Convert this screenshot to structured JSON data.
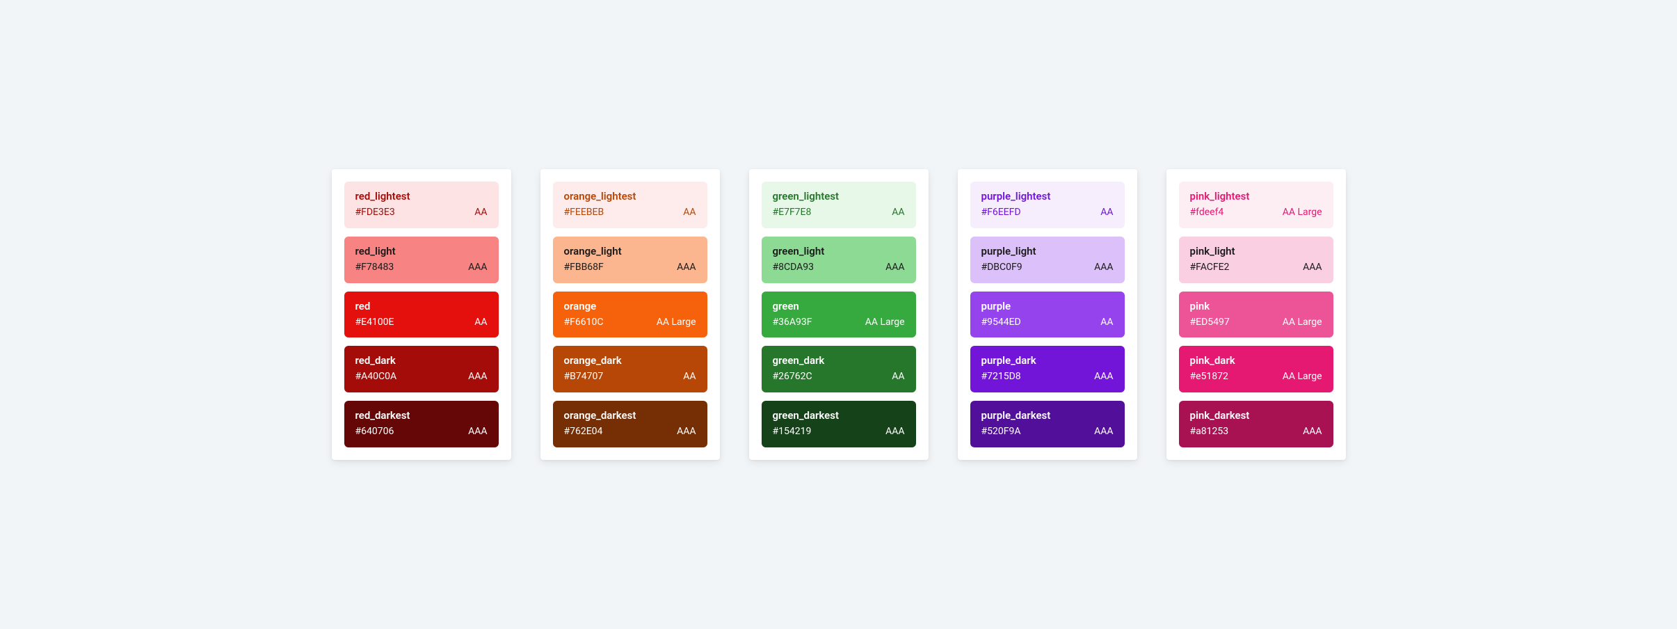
{
  "groups": [
    {
      "swatches": [
        {
          "name": "red_lightest",
          "hex": "#FDE3E3",
          "rating": "AA",
          "bg": "#FDE3E3",
          "fg": "#A40C0A"
        },
        {
          "name": "red_light",
          "hex": "#F78483",
          "rating": "AAA",
          "bg": "#F78483",
          "fg": "#1a1a1a"
        },
        {
          "name": "red",
          "hex": "#E4100E",
          "rating": "AA",
          "bg": "#E4100E",
          "fg": "#ffffff"
        },
        {
          "name": "red_dark",
          "hex": "#A40C0A",
          "rating": "AAA",
          "bg": "#A40C0A",
          "fg": "#ffffff"
        },
        {
          "name": "red_darkest",
          "hex": "#640706",
          "rating": "AAA",
          "bg": "#640706",
          "fg": "#ffffff"
        }
      ]
    },
    {
      "swatches": [
        {
          "name": "orange_lightest",
          "hex": "#FEEBEB",
          "rating": "AA",
          "bg": "#FEEBEB",
          "fg": "#B74707"
        },
        {
          "name": "orange_light",
          "hex": "#FBB68F",
          "rating": "AAA",
          "bg": "#FBB68F",
          "fg": "#1a1a1a"
        },
        {
          "name": "orange",
          "hex": "#F6610C",
          "rating": "AA Large",
          "bg": "#F6610C",
          "fg": "#ffffff"
        },
        {
          "name": "orange_dark",
          "hex": "#B74707",
          "rating": "AA",
          "bg": "#B74707",
          "fg": "#ffffff"
        },
        {
          "name": "orange_darkest",
          "hex": "#762E04",
          "rating": "AAA",
          "bg": "#762E04",
          "fg": "#ffffff"
        }
      ]
    },
    {
      "swatches": [
        {
          "name": "green_lightest",
          "hex": "#E7F7E8",
          "rating": "AA",
          "bg": "#E7F7E8",
          "fg": "#26762C"
        },
        {
          "name": "green_light",
          "hex": "#8CDA93",
          "rating": "AAA",
          "bg": "#8CDA93",
          "fg": "#1a1a1a"
        },
        {
          "name": "green",
          "hex": "#36A93F",
          "rating": "AA Large",
          "bg": "#36A93F",
          "fg": "#ffffff"
        },
        {
          "name": "green_dark",
          "hex": "#26762C",
          "rating": "AA",
          "bg": "#26762C",
          "fg": "#ffffff"
        },
        {
          "name": "green_darkest",
          "hex": "#154219",
          "rating": "AAA",
          "bg": "#154219",
          "fg": "#ffffff"
        }
      ]
    },
    {
      "swatches": [
        {
          "name": "purple_lightest",
          "hex": "#F6EEFD",
          "rating": "AA",
          "bg": "#F6EEFD",
          "fg": "#7215D8"
        },
        {
          "name": "purple_light",
          "hex": "#DBC0F9",
          "rating": "AAA",
          "bg": "#DBC0F9",
          "fg": "#1a1a1a"
        },
        {
          "name": "purple",
          "hex": "#9544ED",
          "rating": "AA",
          "bg": "#9544ED",
          "fg": "#ffffff"
        },
        {
          "name": "purple_dark",
          "hex": "#7215D8",
          "rating": "AAA",
          "bg": "#7215D8",
          "fg": "#ffffff"
        },
        {
          "name": "purple_darkest",
          "hex": "#520F9A",
          "rating": "AAA",
          "bg": "#520F9A",
          "fg": "#ffffff"
        }
      ]
    },
    {
      "swatches": [
        {
          "name": "pink_lightest",
          "hex": "#fdeef4",
          "rating": "AA Large",
          "bg": "#fdeef4",
          "fg": "#e51872"
        },
        {
          "name": "pink_light",
          "hex": "#FACFE2",
          "rating": "AAA",
          "bg": "#FACFE2",
          "fg": "#1a1a1a"
        },
        {
          "name": "pink",
          "hex": "#ED5497",
          "rating": "AA Large",
          "bg": "#ED5497",
          "fg": "#ffffff"
        },
        {
          "name": "pink_dark",
          "hex": "#e51872",
          "rating": "AA Large",
          "bg": "#e51872",
          "fg": "#ffffff"
        },
        {
          "name": "pink_darkest",
          "hex": "#a81253",
          "rating": "AAA",
          "bg": "#a81253",
          "fg": "#ffffff"
        }
      ]
    }
  ]
}
